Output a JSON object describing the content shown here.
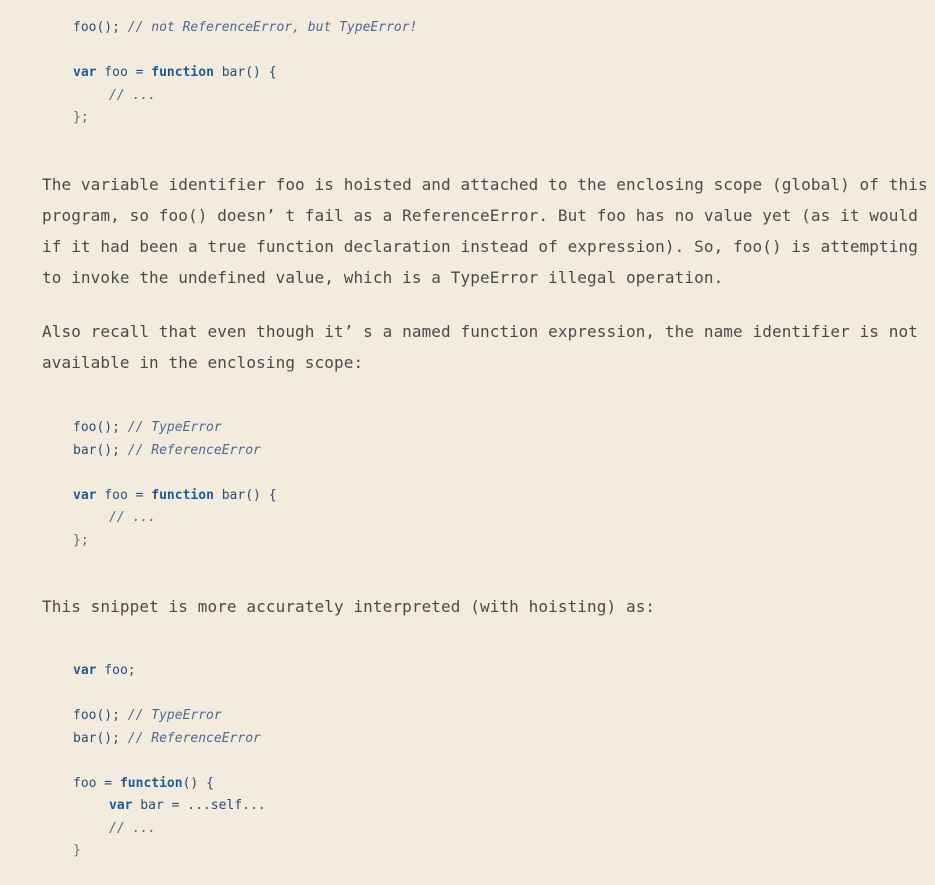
{
  "code_block_1": {
    "lines": [
      {
        "parts": [
          [
            "foo();",
            "id"
          ],
          [
            " // not ReferenceError, but TypeError!",
            "cm"
          ]
        ]
      },
      {
        "blank": true
      },
      {
        "parts": [
          [
            "var",
            "kw"
          ],
          [
            " foo = ",
            "id"
          ],
          [
            "function",
            "kw"
          ],
          [
            " bar() {",
            "id"
          ]
        ]
      },
      {
        "indent": true,
        "parts": [
          [
            "// ...",
            "cm"
          ]
        ]
      },
      {
        "parts": [
          [
            "};",
            "pn"
          ]
        ]
      }
    ]
  },
  "paragraph_1": {
    "lines": [
      "The variable identifier foo is hoisted and attached to the enclosing scope (global) of this",
      "program, so foo() doesn’ t fail as a ReferenceError. But foo has no value yet (as it would",
      "if it had been a true function declaration instead of expression). So, foo() is attempting",
      "to invoke the undefined value, which is a TypeError illegal operation."
    ]
  },
  "paragraph_2": {
    "lines": [
      "Also recall that even though it’ s a named function expression, the name identifier is not",
      "available in the enclosing scope:"
    ]
  },
  "code_block_2": {
    "lines": [
      {
        "parts": [
          [
            "foo();",
            "id"
          ],
          [
            " // TypeError",
            "cm"
          ]
        ]
      },
      {
        "parts": [
          [
            "bar();",
            "id"
          ],
          [
            " // ReferenceError",
            "cm"
          ]
        ]
      },
      {
        "blank": true
      },
      {
        "parts": [
          [
            "var",
            "kw"
          ],
          [
            " foo = ",
            "id"
          ],
          [
            "function",
            "kw"
          ],
          [
            " bar() {",
            "id"
          ]
        ]
      },
      {
        "indent": true,
        "parts": [
          [
            "// ...",
            "cm"
          ]
        ]
      },
      {
        "parts": [
          [
            "};",
            "pn"
          ]
        ]
      }
    ]
  },
  "paragraph_3": {
    "lines": [
      "This snippet is more accurately interpreted (with hoisting) as:"
    ]
  },
  "code_block_3": {
    "lines": [
      {
        "parts": [
          [
            "var",
            "kw"
          ],
          [
            " foo;",
            "id"
          ]
        ]
      },
      {
        "blank": true
      },
      {
        "parts": [
          [
            "foo();",
            "id"
          ],
          [
            " // TypeError",
            "cm"
          ]
        ]
      },
      {
        "parts": [
          [
            "bar();",
            "id"
          ],
          [
            " // ReferenceError",
            "cm"
          ]
        ]
      },
      {
        "blank": true
      },
      {
        "parts": [
          [
            "foo = ",
            "id"
          ],
          [
            "function",
            "kw"
          ],
          [
            "() {",
            "id"
          ]
        ]
      },
      {
        "indent": true,
        "parts": [
          [
            "var",
            "kw"
          ],
          [
            " bar = ...self...",
            "id"
          ]
        ]
      },
      {
        "indent": true,
        "parts": [
          [
            "// ...",
            "cm"
          ]
        ]
      },
      {
        "parts": [
          [
            "}",
            "pn"
          ]
        ]
      }
    ]
  }
}
